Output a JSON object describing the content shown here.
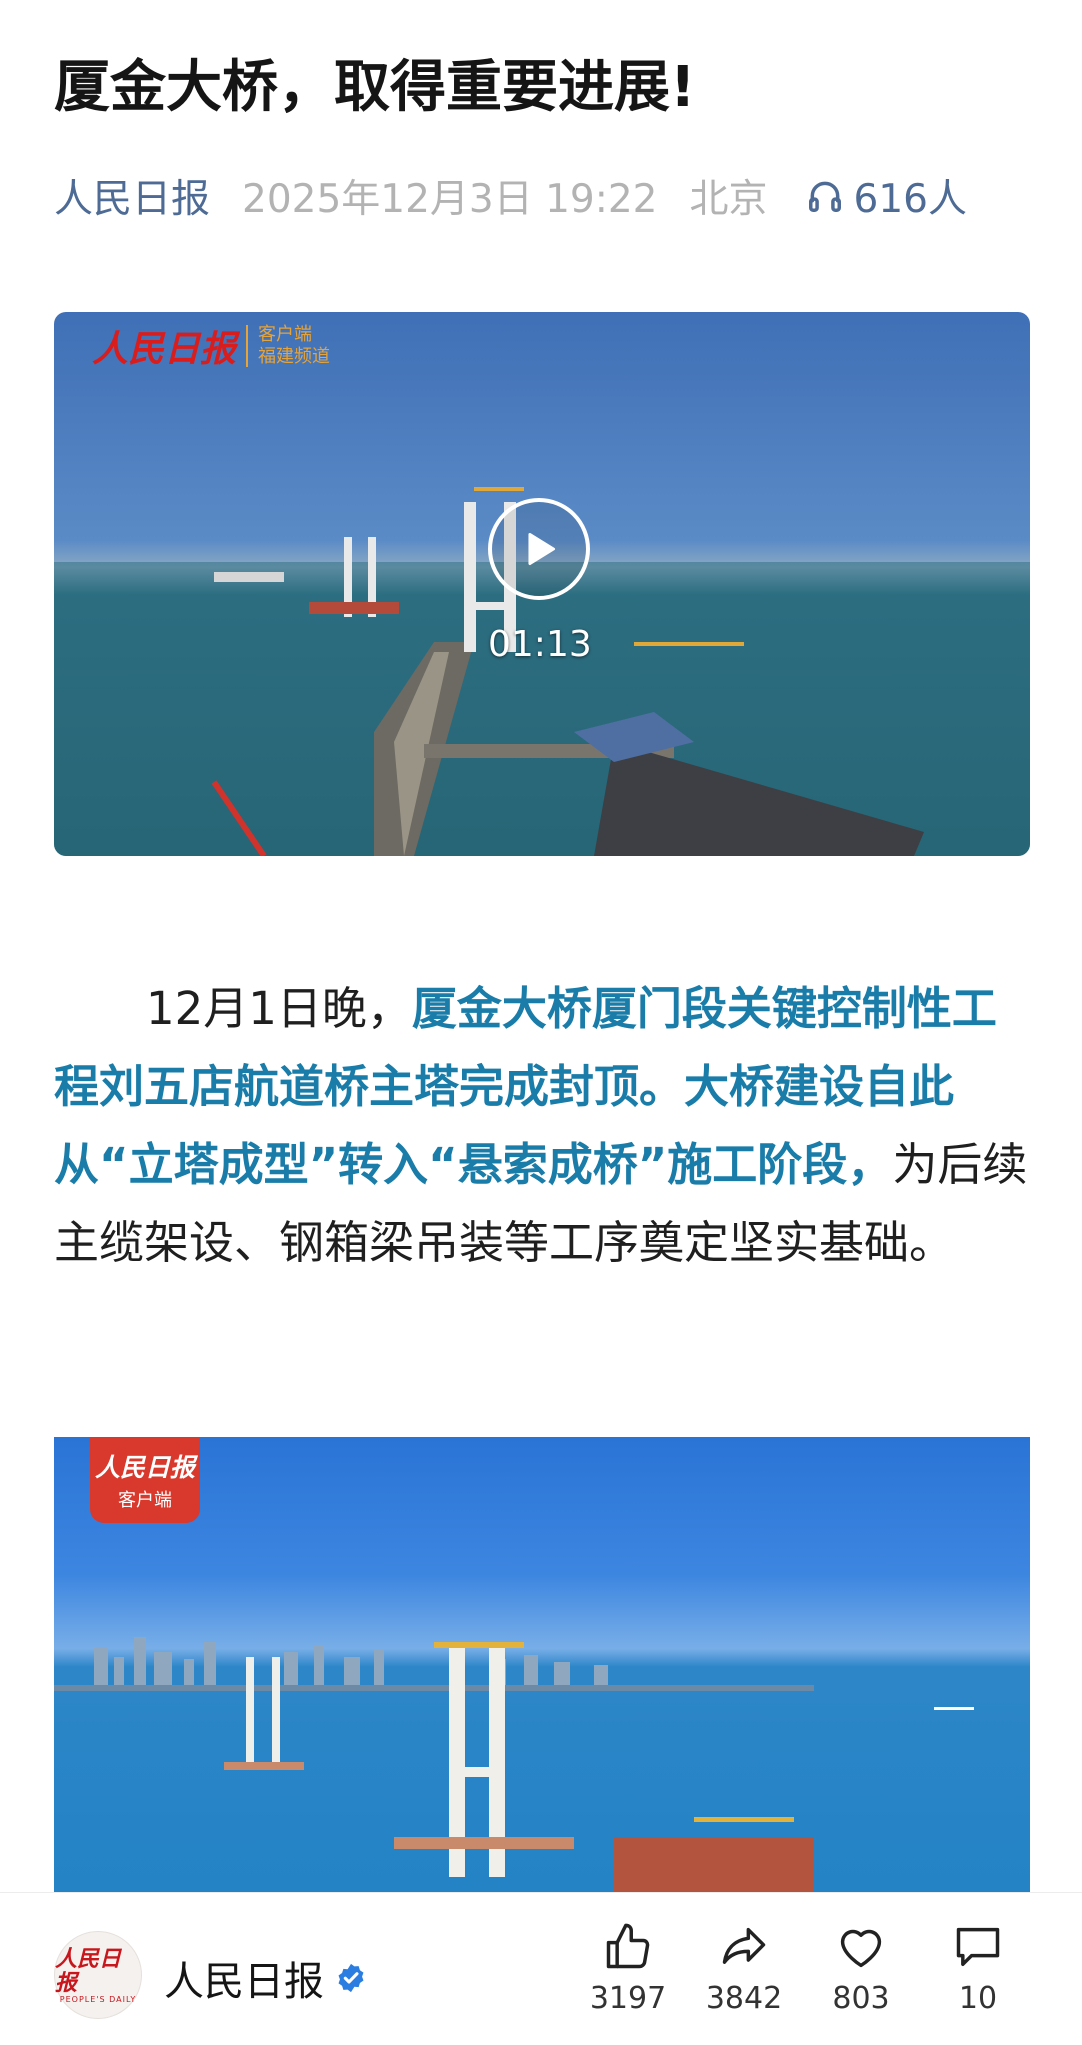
{
  "article": {
    "title": "厦金大桥，取得重要进展!",
    "source": "人民日报",
    "date": "2025年12月3日 19:22",
    "location": "北京",
    "listeners": "616人"
  },
  "video": {
    "logo_main": "人民日报",
    "logo_sub_1": "客户端",
    "logo_sub_2": "福建频道",
    "duration": "01:13"
  },
  "paragraph": {
    "lead": "12月1日晚，",
    "highlight": "厦金大桥厦门段关键控制性工程刘五店航道桥主塔完成封顶。大桥建设自此从“立塔成型”转入“悬索成桥”施工阶段，",
    "rest": "为后续主缆架设、钢箱梁吊装等工序奠定坚实基础。"
  },
  "photo": {
    "badge_main": "人民日报",
    "badge_sub": "客户端"
  },
  "bottom_bar": {
    "avatar_text": "人民日报",
    "avatar_en": "PEOPLE'S DAILY",
    "account_name": "人民日报",
    "likes": "3197",
    "shares": "3842",
    "favorites": "803",
    "comments": "10"
  },
  "colors": {
    "source_blue": "#4d6b95",
    "highlight_blue": "#1a7ca8",
    "verified_blue": "#2a7de1"
  }
}
